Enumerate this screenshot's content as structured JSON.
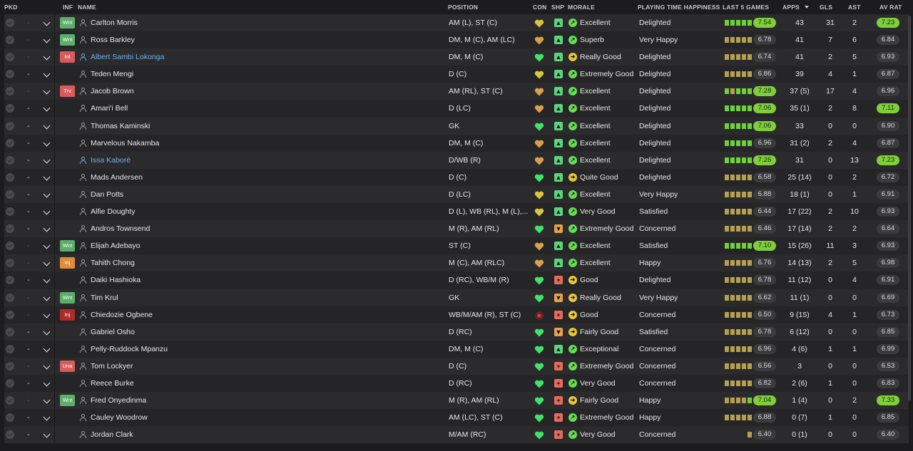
{
  "header": {
    "pkd": "PKD",
    "inf": "INF",
    "name": "NAME",
    "position": "POSITION",
    "con": "CON",
    "shp": "SHP",
    "morale": "MORALE",
    "happiness": "PLAYING TIME HAPPINESS",
    "last5": "LAST 5 GAMES",
    "apps": "APPS",
    "gls": "GLS",
    "ast": "AST",
    "avrat": "AV RAT"
  },
  "colors": {
    "good": "#7fcf3a",
    "bar_green": "#6fd13a",
    "bar_tan": "#b6a04f",
    "heart_green": "#40e36a",
    "heart_yellow": "#d8c63a",
    "heart_orange": "#d8a04a",
    "shp_green": "#59d67a",
    "shp_orange": "#e6a04a",
    "shp_red": "#e86a5a",
    "morale_green": "#66dd55",
    "morale_yellow": "#e8c73a",
    "morale_red": "#e8735a"
  },
  "players": [
    {
      "dash": "-",
      "inf": "Wnt",
      "name": "Carlton Morris",
      "blue": false,
      "position": "AM (L), ST (C)",
      "con": "yellow",
      "shp": "green",
      "morale_ic": "green",
      "morale": "Excellent",
      "happiness": "Delighted",
      "bars": [
        "g",
        "g",
        "g",
        "g",
        "g"
      ],
      "last5": "7.54",
      "last5_hi": true,
      "apps": "43",
      "gls": "31",
      "ast": "2",
      "rat": "7.23",
      "rat_hi": true
    },
    {
      "dash": "-",
      "inf": "Wnt",
      "name": "Ross Barkley",
      "blue": false,
      "position": "DM, M (C), AM (LC)",
      "con": "orange",
      "shp": "green",
      "morale_ic": "green",
      "morale": "Superb",
      "happiness": "Very Happy",
      "bars": [
        "t",
        "t",
        "t",
        "t",
        "t"
      ],
      "last5": "6.78",
      "last5_hi": false,
      "apps": "41",
      "gls": "7",
      "ast": "6",
      "rat": "6.84",
      "rat_hi": false
    },
    {
      "dash": "-",
      "inf": "Int",
      "name": "Albert Sambi Lokonga",
      "blue": true,
      "position": "DM, M (C)",
      "con": "green",
      "shp": "green",
      "morale_ic": "yellow",
      "morale": "Really Good",
      "happiness": "Delighted",
      "bars": [
        "t",
        "t",
        "t",
        "t",
        "t"
      ],
      "last5": "6.74",
      "last5_hi": false,
      "apps": "41",
      "gls": "2",
      "ast": "5",
      "rat": "6.93",
      "rat_hi": false
    },
    {
      "dash": "-",
      "inf": "",
      "name": "Teden Mengi",
      "blue": false,
      "position": "D (C)",
      "con": "yellow",
      "shp": "green",
      "morale_ic": "green",
      "morale": "Extremely Good",
      "happiness": "Delighted",
      "bars": [
        "t",
        "t",
        "t",
        "t",
        "t"
      ],
      "last5": "6.86",
      "last5_hi": false,
      "apps": "39",
      "gls": "4",
      "ast": "1",
      "rat": "6.87",
      "rat_hi": false
    },
    {
      "dash": "-",
      "inf": "Trv",
      "name": "Jacob Brown",
      "blue": false,
      "position": "AM (RL), ST (C)",
      "con": "orange",
      "shp": "green",
      "morale_ic": "green",
      "morale": "Excellent",
      "happiness": "Delighted",
      "bars": [
        "g",
        "t",
        "g",
        "g",
        "g"
      ],
      "last5": "7.28",
      "last5_hi": true,
      "apps": "37 (5)",
      "gls": "17",
      "ast": "4",
      "rat": "6.96",
      "rat_hi": false
    },
    {
      "dash": "-",
      "inf": "",
      "name": "Amari'i Bell",
      "blue": false,
      "position": "D (LC)",
      "con": "orange",
      "shp": "green",
      "morale_ic": "green",
      "morale": "Excellent",
      "happiness": "Delighted",
      "bars": [
        "g",
        "g",
        "g",
        "g",
        "g"
      ],
      "last5": "7.06",
      "last5_hi": true,
      "apps": "35 (1)",
      "gls": "2",
      "ast": "8",
      "rat": "7.11",
      "rat_hi": true
    },
    {
      "dash": "-",
      "inf": "",
      "name": "Thomas Kaminski",
      "blue": false,
      "position": "GK",
      "con": "green",
      "shp": "green",
      "morale_ic": "green",
      "morale": "Excellent",
      "happiness": "Delighted",
      "bars": [
        "g",
        "g",
        "g",
        "g",
        "g"
      ],
      "last5": "7.06",
      "last5_hi": true,
      "apps": "33",
      "gls": "0",
      "ast": "0",
      "rat": "6.90",
      "rat_hi": false
    },
    {
      "dash": "-",
      "inf": "",
      "name": "Marvelous Nakamba",
      "blue": false,
      "position": "DM, M (C)",
      "con": "orange",
      "shp": "green",
      "morale_ic": "green",
      "morale": "Excellent",
      "happiness": "Delighted",
      "bars": [
        "g",
        "g",
        "g",
        "g",
        "g"
      ],
      "last5": "6.96",
      "last5_hi": false,
      "apps": "31 (2)",
      "gls": "2",
      "ast": "4",
      "rat": "6.87",
      "rat_hi": false
    },
    {
      "dash": "-",
      "inf": "",
      "name": "Issa Kaboré",
      "blue": true,
      "position": "D/WB (R)",
      "con": "orange",
      "shp": "green",
      "morale_ic": "green",
      "morale": "Excellent",
      "happiness": "Delighted",
      "bars": [
        "g",
        "g",
        "g",
        "g",
        "g"
      ],
      "last5": "7.26",
      "last5_hi": true,
      "apps": "31",
      "gls": "0",
      "ast": "13",
      "rat": "7.23",
      "rat_hi": true
    },
    {
      "dash": "-",
      "inf": "",
      "name": "Mads Andersen",
      "blue": false,
      "position": "D (C)",
      "con": "green",
      "shp": "green",
      "morale_ic": "yellow",
      "morale": "Quite Good",
      "happiness": "Delighted",
      "bars": [
        "t",
        "t",
        "t",
        "t",
        "t"
      ],
      "last5": "6.58",
      "last5_hi": false,
      "apps": "25 (14)",
      "gls": "0",
      "ast": "2",
      "rat": "6.72",
      "rat_hi": false
    },
    {
      "dash": "-",
      "inf": "",
      "name": "Dan Potts",
      "blue": false,
      "position": "D (LC)",
      "con": "yellow",
      "shp": "green",
      "morale_ic": "green",
      "morale": "Excellent",
      "happiness": "Very Happy",
      "bars": [
        "t",
        "t",
        "t",
        "t",
        "t"
      ],
      "last5": "6.88",
      "last5_hi": false,
      "apps": "18 (1)",
      "gls": "0",
      "ast": "1",
      "rat": "6.91",
      "rat_hi": false
    },
    {
      "dash": "-",
      "inf": "",
      "name": "Alfie Doughty",
      "blue": false,
      "position": "D (L), WB (RL), M (L),...",
      "con": "yellow",
      "shp": "green",
      "morale_ic": "green",
      "morale": "Very Good",
      "happiness": "Satisfied",
      "bars": [
        "t",
        "t",
        "t",
        "t",
        "t"
      ],
      "last5": "6.44",
      "last5_hi": false,
      "apps": "17 (22)",
      "gls": "2",
      "ast": "10",
      "rat": "6.93",
      "rat_hi": false
    },
    {
      "dash": "-",
      "inf": "",
      "name": "Andros Townsend",
      "blue": false,
      "position": "M (R), AM (RL)",
      "con": "green",
      "shp": "orange",
      "morale_ic": "green",
      "morale": "Extremely Good",
      "happiness": "Concerned",
      "bars": [
        "t",
        "t",
        "t",
        "t",
        "t"
      ],
      "last5": "6.46",
      "last5_hi": false,
      "apps": "17 (14)",
      "gls": "2",
      "ast": "2",
      "rat": "6.64",
      "rat_hi": false
    },
    {
      "dash": "-",
      "inf": "Wnt",
      "name": "Elijah Adebayo",
      "blue": false,
      "position": "ST (C)",
      "con": "orange",
      "shp": "green",
      "morale_ic": "green",
      "morale": "Excellent",
      "happiness": "Satisfied",
      "bars": [
        "g",
        "g",
        "g",
        "g",
        "g"
      ],
      "last5": "7.10",
      "last5_hi": true,
      "apps": "15 (26)",
      "gls": "11",
      "ast": "3",
      "rat": "6.93",
      "rat_hi": false
    },
    {
      "dash": "-",
      "inf": "Inj",
      "name": "Tahith Chong",
      "blue": false,
      "position": "M (C), AM (RLC)",
      "con": "orange",
      "shp": "green",
      "morale_ic": "green",
      "morale": "Excellent",
      "happiness": "Happy",
      "bars": [
        "t",
        "t",
        "t",
        "t",
        "t"
      ],
      "last5": "6.76",
      "last5_hi": false,
      "apps": "14 (13)",
      "gls": "2",
      "ast": "5",
      "rat": "6.98",
      "rat_hi": false
    },
    {
      "dash": "-",
      "inf": "",
      "name": "Daiki Hashioka",
      "blue": false,
      "position": "D (RC), WB/M (R)",
      "con": "green",
      "shp": "red",
      "morale_ic": "yellow",
      "morale": "Good",
      "happiness": "Delighted",
      "bars": [
        "t",
        "t",
        "t",
        "t",
        "t"
      ],
      "last5": "6.78",
      "last5_hi": false,
      "apps": "11 (12)",
      "gls": "0",
      "ast": "4",
      "rat": "6.91",
      "rat_hi": false
    },
    {
      "dash": "-",
      "inf": "Wnt",
      "name": "Tim Krul",
      "blue": false,
      "position": "GK",
      "con": "green",
      "shp": "orange",
      "morale_ic": "yellow",
      "morale": "Really Good",
      "happiness": "Very Happy",
      "bars": [
        "t",
        "t",
        "t",
        "t",
        "t"
      ],
      "last5": "6.62",
      "last5_hi": false,
      "apps": "11 (1)",
      "gls": "0",
      "ast": "0",
      "rat": "6.69",
      "rat_hi": false
    },
    {
      "dash": "-",
      "inf": "Inj2",
      "name": "Chiedozie Ogbene",
      "blue": false,
      "position": "WB/M/AM (R), ST (C)",
      "con": "red",
      "shp": "red",
      "morale_ic": "yellow",
      "morale": "Good",
      "happiness": "Concerned",
      "bars": [
        "t",
        "t",
        "t",
        "t",
        "t"
      ],
      "last5": "6.50",
      "last5_hi": false,
      "apps": "9 (15)",
      "gls": "4",
      "ast": "1",
      "rat": "6.73",
      "rat_hi": false
    },
    {
      "dash": "-",
      "inf": "",
      "name": "Gabriel Osho",
      "blue": false,
      "position": "D (RC)",
      "con": "green",
      "shp": "orange",
      "morale_ic": "yellow",
      "morale": "Fairly Good",
      "happiness": "Satisfied",
      "bars": [
        "t",
        "t",
        "t",
        "t",
        "t"
      ],
      "last5": "6.78",
      "last5_hi": false,
      "apps": "6 (12)",
      "gls": "0",
      "ast": "0",
      "rat": "6.85",
      "rat_hi": false
    },
    {
      "dash": "-",
      "inf": "",
      "name": "Pelly-Ruddock Mpanzu",
      "blue": false,
      "position": "DM, M (C)",
      "con": "green",
      "shp": "green",
      "morale_ic": "green",
      "morale": "Exceptional",
      "happiness": "Concerned",
      "bars": [
        "t",
        "t",
        "t",
        "t",
        "t"
      ],
      "last5": "6.96",
      "last5_hi": false,
      "apps": "4 (6)",
      "gls": "1",
      "ast": "1",
      "rat": "6.99",
      "rat_hi": false
    },
    {
      "dash": "-",
      "inf": "Una",
      "name": "Tom Lockyer",
      "blue": false,
      "position": "D (C)",
      "con": "green",
      "shp": "red",
      "morale_ic": "green",
      "morale": "Extremely Good",
      "happiness": "Concerned",
      "bars": [
        "t",
        "t",
        "t",
        "t",
        "t"
      ],
      "last5": "6.56",
      "last5_hi": false,
      "apps": "3",
      "gls": "0",
      "ast": "0",
      "rat": "6.53",
      "rat_hi": false
    },
    {
      "dash": "-",
      "inf": "",
      "name": "Reece Burke",
      "blue": false,
      "position": "D (RC)",
      "con": "green",
      "shp": "red",
      "morale_ic": "green",
      "morale": "Very Good",
      "happiness": "Concerned",
      "bars": [
        "t",
        "t",
        "t",
        "t",
        "t"
      ],
      "last5": "6.82",
      "last5_hi": false,
      "apps": "2 (6)",
      "gls": "1",
      "ast": "0",
      "rat": "6.83",
      "rat_hi": false
    },
    {
      "dash": "-",
      "inf": "Wnt",
      "name": "Fred Onyedinma",
      "blue": false,
      "position": "M (R), AM (RL)",
      "con": "green",
      "shp": "red",
      "morale_ic": "yellow",
      "morale": "Fairly Good",
      "happiness": "Happy",
      "bars": [
        "t",
        "t",
        "t",
        "t",
        "g"
      ],
      "last5": "7.04",
      "last5_hi": true,
      "apps": "1 (4)",
      "gls": "0",
      "ast": "2",
      "rat": "7.33",
      "rat_hi": true
    },
    {
      "dash": "-",
      "inf": "",
      "name": "Cauley Woodrow",
      "blue": false,
      "position": "AM (LC), ST (C)",
      "con": "green",
      "shp": "red",
      "morale_ic": "green",
      "morale": "Extremely Good",
      "happiness": "Happy",
      "bars": [
        "t",
        "t",
        "t",
        "t",
        "t"
      ],
      "last5": "6.88",
      "last5_hi": false,
      "apps": "0 (7)",
      "gls": "1",
      "ast": "0",
      "rat": "6.85",
      "rat_hi": false
    },
    {
      "dash": "-",
      "inf": "",
      "name": "Jordan Clark",
      "blue": false,
      "position": "M/AM (RC)",
      "con": "green",
      "shp": "red",
      "morale_ic": "green",
      "morale": "Very Good",
      "happiness": "Concerned",
      "bars": [
        "",
        "",
        "",
        "",
        "t"
      ],
      "last5": "6.40",
      "last5_hi": false,
      "apps": "0 (1)",
      "gls": "0",
      "ast": "0",
      "rat": "6.40",
      "rat_hi": false
    }
  ]
}
